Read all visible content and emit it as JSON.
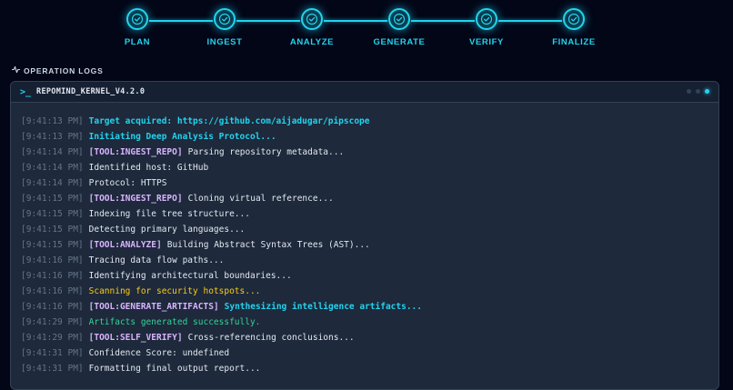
{
  "steps": [
    {
      "label": "PLAN",
      "icon": "check-circle-icon"
    },
    {
      "label": "INGEST",
      "icon": "check-circle-icon"
    },
    {
      "label": "ANALYZE",
      "icon": "check-circle-icon"
    },
    {
      "label": "GENERATE",
      "icon": "check-circle-icon"
    },
    {
      "label": "VERIFY",
      "icon": "check-circle-icon"
    },
    {
      "label": "FINALIZE",
      "icon": "check-circle-icon"
    }
  ],
  "colors": {
    "accent": "#22d3ee",
    "tag": "#d8b4fe",
    "warning": "#facc15",
    "success": "#34d399"
  },
  "logs_section": {
    "title": "OPERATION LOGS",
    "icon": "activity-icon"
  },
  "terminal": {
    "prompt_icon": ">_",
    "title": "REPOMIND_KERNEL_V4.2.0",
    "lines": [
      {
        "ts": "[9:41:13 PM]",
        "tag": "",
        "msg": "Target acquired: https://github.com/aijadugar/pipscope",
        "style": "cyan"
      },
      {
        "ts": "[9:41:13 PM]",
        "tag": "",
        "msg": "Initiating Deep Analysis Protocol...",
        "style": "cyan"
      },
      {
        "ts": "[9:41:14 PM]",
        "tag": "[TOOL:INGEST_REPO]",
        "msg": "Parsing repository metadata...",
        "style": "default"
      },
      {
        "ts": "[9:41:14 PM]",
        "tag": "",
        "msg": "Identified host: GitHub",
        "style": "default"
      },
      {
        "ts": "[9:41:14 PM]",
        "tag": "",
        "msg": "Protocol: HTTPS",
        "style": "default"
      },
      {
        "ts": "[9:41:15 PM]",
        "tag": "[TOOL:INGEST_REPO]",
        "msg": "Cloning virtual reference...",
        "style": "default"
      },
      {
        "ts": "[9:41:15 PM]",
        "tag": "",
        "msg": "Indexing file tree structure...",
        "style": "default"
      },
      {
        "ts": "[9:41:15 PM]",
        "tag": "",
        "msg": "Detecting primary languages...",
        "style": "default"
      },
      {
        "ts": "[9:41:15 PM]",
        "tag": "[TOOL:ANALYZE]",
        "msg": "Building Abstract Syntax Trees (AST)...",
        "style": "default"
      },
      {
        "ts": "[9:41:16 PM]",
        "tag": "",
        "msg": "Tracing data flow paths...",
        "style": "default"
      },
      {
        "ts": "[9:41:16 PM]",
        "tag": "",
        "msg": "Identifying architectural boundaries...",
        "style": "default"
      },
      {
        "ts": "[9:41:16 PM]",
        "tag": "",
        "msg": "Scanning for security hotspots...",
        "style": "yellow"
      },
      {
        "ts": "[9:41:16 PM]",
        "tag": "[TOOL:GENERATE_ARTIFACTS]",
        "msg": "Synthesizing intelligence artifacts...",
        "style": "cyan"
      },
      {
        "ts": "[9:41:29 PM]",
        "tag": "",
        "msg": "Artifacts generated successfully.",
        "style": "green"
      },
      {
        "ts": "[9:41:29 PM]",
        "tag": "[TOOL:SELF_VERIFY]",
        "msg": "Cross-referencing conclusions...",
        "style": "default"
      },
      {
        "ts": "[9:41:31 PM]",
        "tag": "",
        "msg": "Confidence Score: undefined",
        "style": "default"
      },
      {
        "ts": "[9:41:31 PM]",
        "tag": "",
        "msg": "Formatting final output report...",
        "style": "default"
      }
    ]
  }
}
